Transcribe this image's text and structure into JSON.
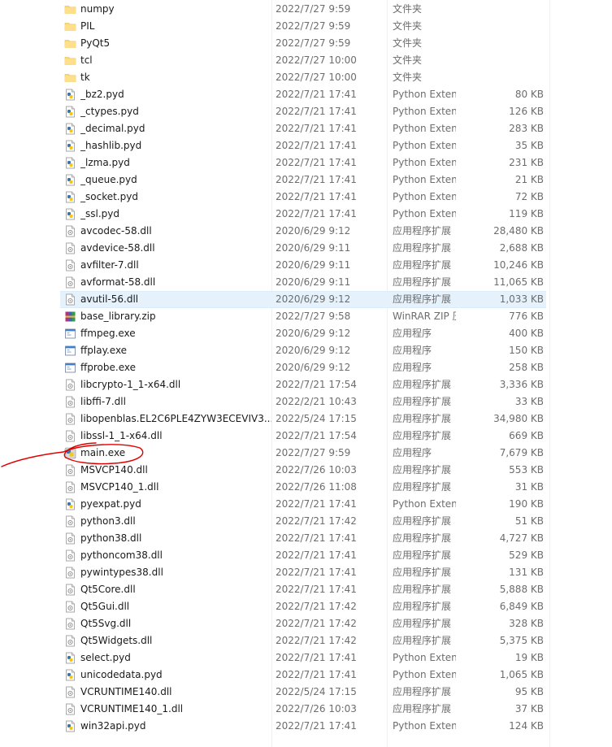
{
  "files": [
    {
      "name": "numpy",
      "date": "2022/7/27 9:59",
      "type": "文件夹",
      "size": "",
      "icon": "folder-icon"
    },
    {
      "name": "PIL",
      "date": "2022/7/27 9:59",
      "type": "文件夹",
      "size": "",
      "icon": "folder-icon"
    },
    {
      "name": "PyQt5",
      "date": "2022/7/27 9:59",
      "type": "文件夹",
      "size": "",
      "icon": "folder-icon"
    },
    {
      "name": "tcl",
      "date": "2022/7/27 10:00",
      "type": "文件夹",
      "size": "",
      "icon": "folder-icon"
    },
    {
      "name": "tk",
      "date": "2022/7/27 10:00",
      "type": "文件夹",
      "size": "",
      "icon": "folder-icon"
    },
    {
      "name": "_bz2.pyd",
      "date": "2022/7/21 17:41",
      "type": "Python Extensio...",
      "size": "80 KB",
      "icon": "python-file-icon"
    },
    {
      "name": "_ctypes.pyd",
      "date": "2022/7/21 17:41",
      "type": "Python Extensio...",
      "size": "126 KB",
      "icon": "python-file-icon"
    },
    {
      "name": "_decimal.pyd",
      "date": "2022/7/21 17:41",
      "type": "Python Extensio...",
      "size": "283 KB",
      "icon": "python-file-icon"
    },
    {
      "name": "_hashlib.pyd",
      "date": "2022/7/21 17:41",
      "type": "Python Extensio...",
      "size": "35 KB",
      "icon": "python-file-icon"
    },
    {
      "name": "_lzma.pyd",
      "date": "2022/7/21 17:41",
      "type": "Python Extensio...",
      "size": "231 KB",
      "icon": "python-file-icon"
    },
    {
      "name": "_queue.pyd",
      "date": "2022/7/21 17:41",
      "type": "Python Extensio...",
      "size": "21 KB",
      "icon": "python-file-icon"
    },
    {
      "name": "_socket.pyd",
      "date": "2022/7/21 17:41",
      "type": "Python Extensio...",
      "size": "72 KB",
      "icon": "python-file-icon"
    },
    {
      "name": "_ssl.pyd",
      "date": "2022/7/21 17:41",
      "type": "Python Extensio...",
      "size": "119 KB",
      "icon": "python-file-icon"
    },
    {
      "name": "avcodec-58.dll",
      "date": "2020/6/29 9:12",
      "type": "应用程序扩展",
      "size": "28,480 KB",
      "icon": "dll-file-icon"
    },
    {
      "name": "avdevice-58.dll",
      "date": "2020/6/29 9:11",
      "type": "应用程序扩展",
      "size": "2,688 KB",
      "icon": "dll-file-icon"
    },
    {
      "name": "avfilter-7.dll",
      "date": "2020/6/29 9:11",
      "type": "应用程序扩展",
      "size": "10,246 KB",
      "icon": "dll-file-icon"
    },
    {
      "name": "avformat-58.dll",
      "date": "2020/6/29 9:11",
      "type": "应用程序扩展",
      "size": "11,065 KB",
      "icon": "dll-file-icon"
    },
    {
      "name": "avutil-56.dll",
      "date": "2020/6/29 9:12",
      "type": "应用程序扩展",
      "size": "1,033 KB",
      "icon": "dll-file-icon",
      "selected": true
    },
    {
      "name": "base_library.zip",
      "date": "2022/7/27 9:58",
      "type": "WinRAR ZIP 压缩...",
      "size": "776 KB",
      "icon": "winrar-archive-icon"
    },
    {
      "name": "ffmpeg.exe",
      "date": "2020/6/29 9:12",
      "type": "应用程序",
      "size": "400 KB",
      "icon": "exe-file-icon"
    },
    {
      "name": "ffplay.exe",
      "date": "2020/6/29 9:12",
      "type": "应用程序",
      "size": "150 KB",
      "icon": "exe-file-icon"
    },
    {
      "name": "ffprobe.exe",
      "date": "2020/6/29 9:12",
      "type": "应用程序",
      "size": "258 KB",
      "icon": "exe-file-icon"
    },
    {
      "name": "libcrypto-1_1-x64.dll",
      "date": "2022/7/21 17:54",
      "type": "应用程序扩展",
      "size": "3,336 KB",
      "icon": "dll-file-icon"
    },
    {
      "name": "libffi-7.dll",
      "date": "2022/2/21 10:43",
      "type": "应用程序扩展",
      "size": "33 KB",
      "icon": "dll-file-icon"
    },
    {
      "name": "libopenblas.EL2C6PLE4ZYW3ECEVIV3...",
      "date": "2022/5/24 17:15",
      "type": "应用程序扩展",
      "size": "34,980 KB",
      "icon": "dll-file-icon"
    },
    {
      "name": "libssl-1_1-x64.dll",
      "date": "2022/7/21 17:54",
      "type": "应用程序扩展",
      "size": "669 KB",
      "icon": "dll-file-icon"
    },
    {
      "name": "main.exe",
      "date": "2022/7/27 9:59",
      "type": "应用程序",
      "size": "7,679 KB",
      "icon": "pyinstaller-exe-icon",
      "circled": true
    },
    {
      "name": "MSVCP140.dll",
      "date": "2022/7/26 10:03",
      "type": "应用程序扩展",
      "size": "553 KB",
      "icon": "dll-file-icon"
    },
    {
      "name": "MSVCP140_1.dll",
      "date": "2022/7/26 11:08",
      "type": "应用程序扩展",
      "size": "31 KB",
      "icon": "dll-file-icon"
    },
    {
      "name": "pyexpat.pyd",
      "date": "2022/7/21 17:41",
      "type": "Python Extensio...",
      "size": "190 KB",
      "icon": "python-file-icon"
    },
    {
      "name": "python3.dll",
      "date": "2022/7/21 17:42",
      "type": "应用程序扩展",
      "size": "51 KB",
      "icon": "dll-file-icon"
    },
    {
      "name": "python38.dll",
      "date": "2022/7/21 17:41",
      "type": "应用程序扩展",
      "size": "4,727 KB",
      "icon": "dll-file-icon"
    },
    {
      "name": "pythoncom38.dll",
      "date": "2022/7/21 17:41",
      "type": "应用程序扩展",
      "size": "529 KB",
      "icon": "dll-file-icon"
    },
    {
      "name": "pywintypes38.dll",
      "date": "2022/7/21 17:41",
      "type": "应用程序扩展",
      "size": "131 KB",
      "icon": "dll-file-icon"
    },
    {
      "name": "Qt5Core.dll",
      "date": "2022/7/21 17:41",
      "type": "应用程序扩展",
      "size": "5,888 KB",
      "icon": "dll-file-icon"
    },
    {
      "name": "Qt5Gui.dll",
      "date": "2022/7/21 17:42",
      "type": "应用程序扩展",
      "size": "6,849 KB",
      "icon": "dll-file-icon"
    },
    {
      "name": "Qt5Svg.dll",
      "date": "2022/7/21 17:42",
      "type": "应用程序扩展",
      "size": "328 KB",
      "icon": "dll-file-icon"
    },
    {
      "name": "Qt5Widgets.dll",
      "date": "2022/7/21 17:42",
      "type": "应用程序扩展",
      "size": "5,375 KB",
      "icon": "dll-file-icon"
    },
    {
      "name": "select.pyd",
      "date": "2022/7/21 17:41",
      "type": "Python Extensio...",
      "size": "19 KB",
      "icon": "python-file-icon"
    },
    {
      "name": "unicodedata.pyd",
      "date": "2022/7/21 17:41",
      "type": "Python Extensio...",
      "size": "1,065 KB",
      "icon": "python-file-icon"
    },
    {
      "name": "VCRUNTIME140.dll",
      "date": "2022/5/24 17:15",
      "type": "应用程序扩展",
      "size": "95 KB",
      "icon": "dll-file-icon"
    },
    {
      "name": "VCRUNTIME140_1.dll",
      "date": "2022/7/26 10:03",
      "type": "应用程序扩展",
      "size": "37 KB",
      "icon": "dll-file-icon"
    },
    {
      "name": "win32api.pyd",
      "date": "2022/7/21 17:41",
      "type": "Python Extensio...",
      "size": "124 KB",
      "icon": "python-file-icon"
    }
  ],
  "colors": {
    "folder": "#f8d775",
    "selection": "#e5f1fb",
    "annotation": "#e00000",
    "secondary_text": "#6d6d6d"
  }
}
